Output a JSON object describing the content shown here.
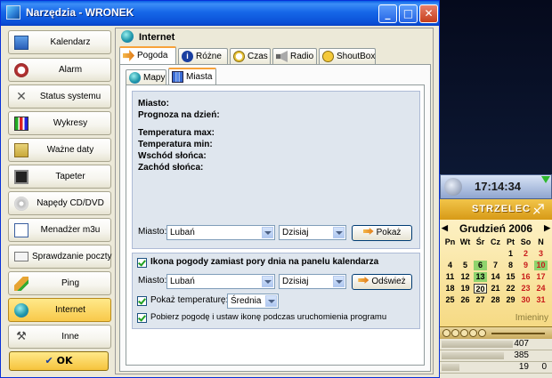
{
  "window": {
    "title": "Narzędzia - WRONEK"
  },
  "sidebar": {
    "items": [
      {
        "label": "Kalendarz",
        "icon": "calendar-icon"
      },
      {
        "label": "Alarm",
        "icon": "alarm-clock-icon"
      },
      {
        "label": "Status systemu",
        "icon": "tools-icon"
      },
      {
        "label": "Wykresy",
        "icon": "chart-icon"
      },
      {
        "label": "Ważne daty",
        "icon": "calendar-note-icon"
      },
      {
        "label": "Tapeter",
        "icon": "monitor-icon"
      },
      {
        "label": "Napędy CD/DVD",
        "icon": "cd-icon"
      },
      {
        "label": "Menadżer m3u",
        "icon": "playlist-icon"
      },
      {
        "label": "Sprawdzanie poczty",
        "icon": "mail-icon"
      },
      {
        "label": "Ping",
        "icon": "pencil-icon"
      },
      {
        "label": "Internet",
        "icon": "globe-icon"
      },
      {
        "label": "Inne",
        "icon": "hammer-icon"
      }
    ],
    "active": "Internet",
    "ok_label": "OK"
  },
  "panel": {
    "title": "Internet",
    "tabs": [
      "Pogoda",
      "Różne",
      "Czas",
      "Radio",
      "ShoutBox"
    ],
    "active_tab": "Pogoda",
    "subtabs": [
      "Mapy",
      "Miasta"
    ],
    "active_subtab": "Miasta",
    "weather": {
      "miasto": "Miasto:",
      "prognoza": "Prognoza na dzień:",
      "temp_max": "Temperatura max:",
      "temp_min": "Temperatura min:",
      "wschod": "Wschód słońca:",
      "zachod": "Zachód słońca:"
    },
    "row1": {
      "label": "Miasto:",
      "city": "Lubań",
      "day": "Dzisiaj",
      "button": "Pokaż"
    },
    "icon_checkbox": "Ikona pogody zamiast pory dnia na panelu kalendarza",
    "row2": {
      "label": "Miasto:",
      "city": "Lubań",
      "day": "Dzisiaj",
      "button": "Odśwież"
    },
    "temp_checkbox": "Pokaż temperaturę:",
    "temp_value": "Średnia",
    "fetch_checkbox": "Pobierz pogodę i ustaw ikonę podczas uruchomienia programu"
  },
  "clock": {
    "time": "17:14:34",
    "zodiac": "STRZELEC",
    "month": "Grudzień 2006",
    "weekdays": [
      "Pn",
      "Wt",
      "Śr",
      "Cz",
      "Pt",
      "So",
      "N"
    ],
    "weeks": [
      [
        "",
        "",
        "",
        "",
        "1",
        "2",
        "3"
      ],
      [
        "4",
        "5",
        "6",
        "7",
        "8",
        "9",
        "10"
      ],
      [
        "11",
        "12",
        "13",
        "14",
        "15",
        "16",
        "17"
      ],
      [
        "18",
        "19",
        "20",
        "21",
        "22",
        "23",
        "24"
      ],
      [
        "25",
        "26",
        "27",
        "28",
        "29",
        "30",
        "31"
      ]
    ],
    "today": "20",
    "highlight": [
      "6",
      "10",
      "13"
    ],
    "name_day": "Imieniny",
    "stats": [
      "407",
      "385",
      "19"
    ],
    "stats_extra": "0"
  }
}
